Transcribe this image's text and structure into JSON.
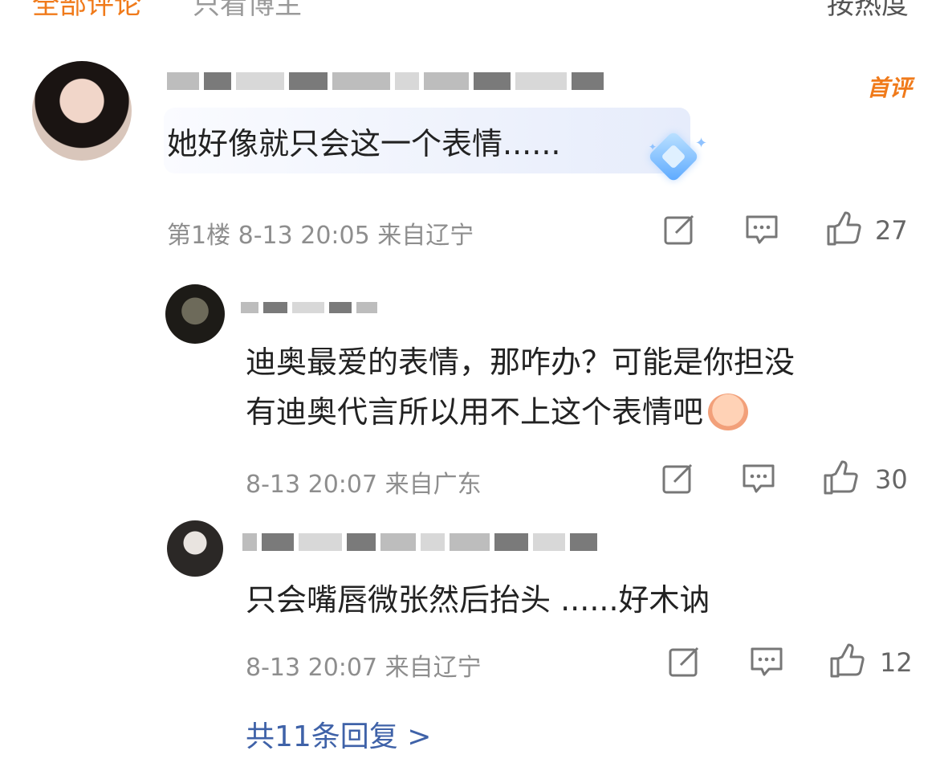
{
  "tabs": {
    "all_comments": "全部评论",
    "author_only": "只看博主",
    "sort": "按热度"
  },
  "comments": [
    {
      "badge": "首评",
      "text": "她好像就只会这一个表情......",
      "floor": "第1楼",
      "time": "8-13 20:05",
      "location": "来自辽宁",
      "likes": "27"
    },
    {
      "text_line1": "迪奥最爱的表情，那咋办？可能是你担没",
      "text_line2": "有迪奥代言所以用不上这个表情吧",
      "time": "8-13 20:07",
      "location": "来自广东",
      "likes": "30"
    },
    {
      "text": "只会嘴唇微张然后抬头 ......好木讷",
      "time": "8-13 20:07",
      "location": "来自辽宁",
      "likes": "12"
    }
  ],
  "more_replies": "共11条回复 >",
  "icons": [
    "share-icon",
    "comment-icon",
    "like-icon",
    "diamond-icon",
    "grin-emoji-icon"
  ],
  "colors": {
    "accent": "#f07a1a",
    "link": "#3f62a8",
    "meta": "#8e8e8e"
  }
}
